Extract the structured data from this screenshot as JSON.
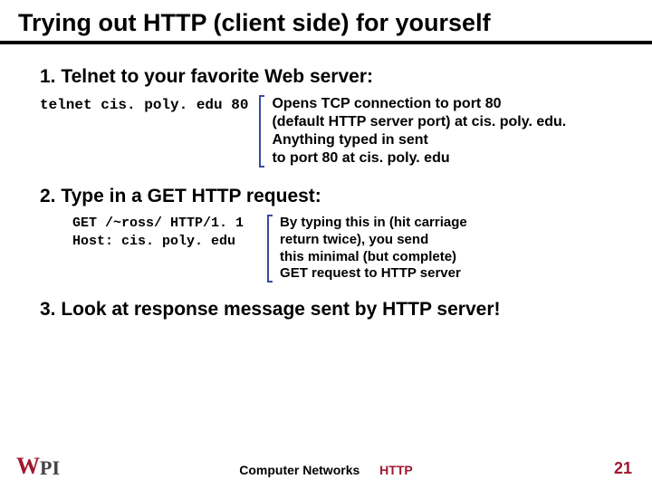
{
  "title": "Trying out HTTP (client side) for yourself",
  "step1": "1. Telnet to your favorite Web server:",
  "cmd1": "telnet cis. poly. edu 80",
  "desc1": "Opens TCP connection to port 80\n(default HTTP server port) at cis. poly. edu.\nAnything typed in sent\nto port 80 at cis. poly. edu",
  "step2": "2. Type in a GET HTTP request:",
  "cmd2": "GET /~ross/ HTTP/1. 1\nHost: cis. poly. edu",
  "desc2": "By typing this in (hit carriage\nreturn twice), you send\nthis minimal (but complete)\nGET request to HTTP server",
  "step3": "3. Look at response message sent by HTTP server!",
  "footer_course": "Computer Networks",
  "footer_topic": "HTTP",
  "page_number": "21",
  "logo_w": "W",
  "logo_pi": "PI"
}
